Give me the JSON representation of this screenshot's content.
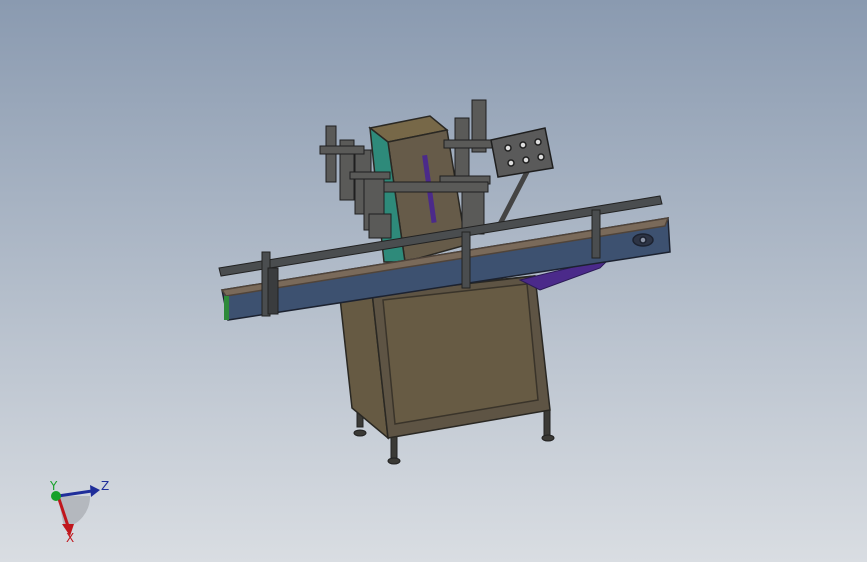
{
  "viewport": {
    "background_top": "#8a9ab0",
    "background_bottom": "#d9dde2"
  },
  "model": {
    "frame_color": "#5c5545",
    "panel_color": "#675b44",
    "conveyor_color": "#3d5170",
    "rail_color": "#4a4d4f",
    "accent_teal": "#2e8a7a",
    "accent_purple": "#4b2a8a",
    "control_box_color": "#5a5a5a"
  },
  "triad": {
    "x_label": "X",
    "y_label": "Y",
    "z_label": "Z",
    "x_color": "#c0161c",
    "y_color": "#17a12a",
    "z_color": "#1f2e9a",
    "icon": "coordinate-triad-icon"
  }
}
